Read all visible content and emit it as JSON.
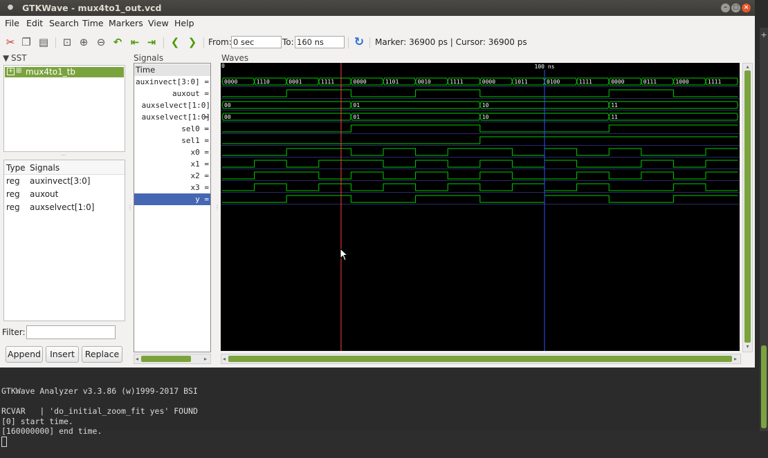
{
  "window": {
    "title": "GTKWave - mux4to1_out.vcd"
  },
  "menu": [
    "File",
    "Edit",
    "Search",
    "Time",
    "Markers",
    "View",
    "Help"
  ],
  "toolbar": {
    "from_label": "From:",
    "from_value": "0 sec",
    "to_label": "To:",
    "to_value": "160 ns",
    "marker_text": "Marker: 36900 ps  |  Cursor: 36900 ps",
    "icons": [
      "cut-icon",
      "copy-icon",
      "paste-icon",
      "zoom-fit-icon",
      "zoom-in-icon",
      "zoom-out-icon",
      "undo-zoom-icon",
      "zoom-to-start-icon",
      "zoom-to-end-icon",
      "prev-edge-icon",
      "next-edge-icon",
      "reload-icon"
    ]
  },
  "sst": {
    "label": "SST",
    "tree_item": "mux4to1_tb",
    "columns": [
      "Type",
      "Signals"
    ],
    "rows": [
      {
        "type": "reg",
        "name": "auxinvect[3:0]"
      },
      {
        "type": "reg",
        "name": "auxout"
      },
      {
        "type": "reg",
        "name": "auxselvect[1:0]"
      }
    ],
    "filter_label": "Filter:",
    "filter_value": "",
    "buttons": [
      "Append",
      "Insert",
      "Replace"
    ]
  },
  "signals": {
    "label": "Signals",
    "time_label": "Time",
    "names": [
      "auxinvect[3:0] =",
      "auxout =",
      "auxselvect[1:0] =",
      "auxselvect[1:0] =",
      "sel0 =",
      "sel1 =",
      "x0 =",
      "x1 =",
      "x2 =",
      "x3 =",
      "y ="
    ],
    "selected_index": 10
  },
  "waves": {
    "label": "Waves",
    "time_start_tick": "0",
    "time_mid_tick": "100 ns",
    "range_ns": [
      0,
      160
    ],
    "marker_ns": 36.9,
    "midline_ns": 100,
    "trace_color": "#00d000",
    "marker_color": "#ff4040",
    "midline_color": "#3050ff",
    "bus": [
      {
        "row": 0,
        "segments": [
          {
            "t": 0,
            "v": "0000"
          },
          {
            "t": 10,
            "v": "1110"
          },
          {
            "t": 20,
            "v": "0001"
          },
          {
            "t": 30,
            "v": "1111"
          },
          {
            "t": 40,
            "v": "0000"
          },
          {
            "t": 50,
            "v": "1101"
          },
          {
            "t": 60,
            "v": "0010"
          },
          {
            "t": 70,
            "v": "1111"
          },
          {
            "t": 80,
            "v": "0000"
          },
          {
            "t": 90,
            "v": "1011"
          },
          {
            "t": 100,
            "v": "0100"
          },
          {
            "t": 110,
            "v": "1111"
          },
          {
            "t": 120,
            "v": "0000"
          },
          {
            "t": 130,
            "v": "0111"
          },
          {
            "t": 140,
            "v": "1000"
          },
          {
            "t": 150,
            "v": "1111"
          }
        ]
      },
      {
        "row": 2,
        "segments": [
          {
            "t": 0,
            "v": "00"
          },
          {
            "t": 40,
            "v": "01"
          },
          {
            "t": 80,
            "v": "10"
          },
          {
            "t": 120,
            "v": "11"
          }
        ]
      },
      {
        "row": 3,
        "segments": [
          {
            "t": 0,
            "v": "00"
          },
          {
            "t": 40,
            "v": "01"
          },
          {
            "t": 80,
            "v": "10"
          },
          {
            "t": 120,
            "v": "11"
          }
        ]
      }
    ],
    "bits": [
      {
        "row": 1,
        "init": 0,
        "edges": [
          20,
          40,
          60,
          80,
          120,
          140
        ]
      },
      {
        "row": 4,
        "init": 0,
        "edges": [
          40,
          80,
          120
        ]
      },
      {
        "row": 5,
        "init": 0,
        "edges": [
          80
        ]
      },
      {
        "row": 6,
        "init": 0,
        "edges": [
          20,
          40,
          50,
          60,
          70,
          90,
          100,
          110,
          120,
          130,
          150
        ]
      },
      {
        "row": 7,
        "init": 0,
        "edges": [
          10,
          20,
          30,
          50,
          60,
          70,
          80,
          90,
          100,
          110,
          130,
          140,
          150
        ]
      },
      {
        "row": 8,
        "init": 0,
        "edges": [
          10,
          30,
          40,
          50,
          60,
          70,
          80,
          90,
          110,
          120,
          130,
          140,
          150
        ]
      },
      {
        "row": 9,
        "init": 0,
        "edges": [
          10,
          20,
          30,
          40,
          50,
          60,
          70,
          80,
          90,
          100,
          110,
          120,
          140,
          150
        ]
      },
      {
        "row": 10,
        "init": 0,
        "edges": [
          20,
          40,
          60,
          80,
          100,
          120,
          140
        ]
      }
    ]
  },
  "terminal": {
    "lines": [
      "GTKWave Analyzer v3.3.86 (w)1999-2017 BSI",
      "",
      "RCVAR   | 'do_initial_zoom_fit yes' FOUND",
      "[0] start time.",
      "[160000000] end time."
    ]
  }
}
